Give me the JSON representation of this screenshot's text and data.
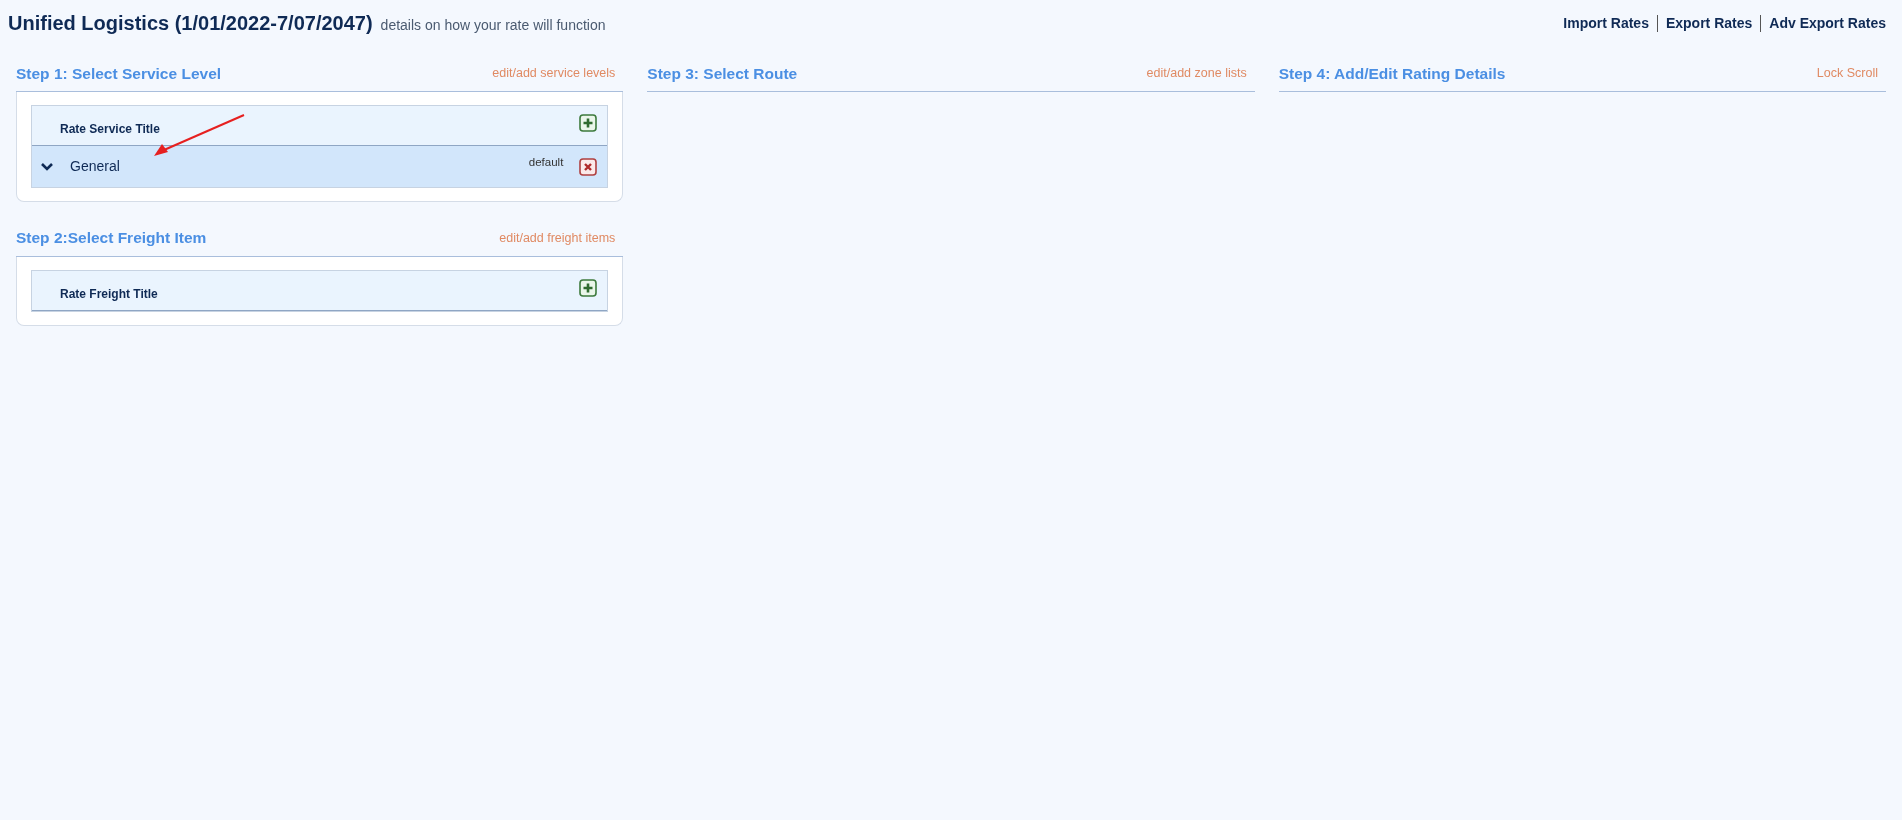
{
  "header": {
    "title": "Unified Logistics (1/01/2022-7/07/2047)",
    "subtitle": "details on how your rate will function"
  },
  "top_links": [
    "Import Rates",
    "Export Rates",
    "Adv Export Rates"
  ],
  "steps": [
    {
      "title": "Step 1: Select Service Level",
      "action": "edit/add service levels",
      "table": {
        "title": "Rate Service Title",
        "rows": [
          {
            "label": "General",
            "tag": "default",
            "selected": true,
            "expanded": false
          }
        ]
      }
    },
    {
      "title": "Step 2:Select Freight Item",
      "action": "edit/add freight items",
      "table": {
        "title": "Rate Freight Title"
      }
    },
    {
      "title": "Step 3: Select Route",
      "action": "edit/add zone lists"
    },
    {
      "title": "Step 4: Add/Edit Rating Details",
      "action": "Lock Scroll"
    }
  ],
  "annotation": {
    "kind": "arrow"
  }
}
